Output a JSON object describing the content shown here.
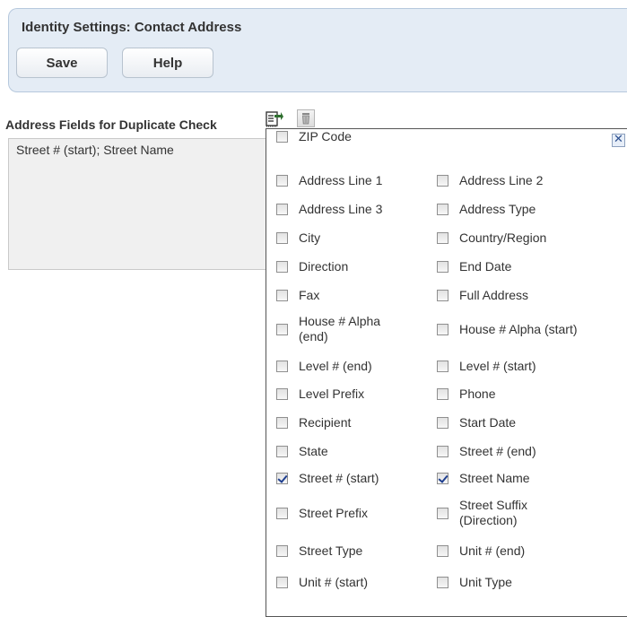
{
  "header": {
    "title": "Identity Settings: Contact Address",
    "save_label": "Save",
    "help_label": "Help"
  },
  "section": {
    "label": "Address Fields for Duplicate Check",
    "value": "Street # (start); Street Name",
    "select_icon": "select-list-icon",
    "clear_icon": "trash-icon"
  },
  "popup": {
    "close_glyph": "✕",
    "options": [
      {
        "label": "Address Line 1",
        "checked": false
      },
      {
        "label": "Address Line 2",
        "checked": false
      },
      {
        "label": "Address Line 3",
        "checked": false
      },
      {
        "label": "Address Type",
        "checked": false
      },
      {
        "label": "City",
        "checked": false
      },
      {
        "label": "Country/Region",
        "checked": false
      },
      {
        "label": "Direction",
        "checked": false
      },
      {
        "label": "End Date",
        "checked": false
      },
      {
        "label": "Fax",
        "checked": false
      },
      {
        "label": "Full Address",
        "checked": false
      },
      {
        "label": "House # Alpha (end)",
        "checked": false
      },
      {
        "label": "House # Alpha (start)",
        "checked": false
      },
      {
        "label": "Level # (end)",
        "checked": false
      },
      {
        "label": "Level # (start)",
        "checked": false
      },
      {
        "label": "Level Prefix",
        "checked": false
      },
      {
        "label": "Phone",
        "checked": false
      },
      {
        "label": "Recipient",
        "checked": false
      },
      {
        "label": "Start Date",
        "checked": false
      },
      {
        "label": "State",
        "checked": false
      },
      {
        "label": "Street # (end)",
        "checked": false
      },
      {
        "label": "Street # (start)",
        "checked": true
      },
      {
        "label": "Street Name",
        "checked": true
      },
      {
        "label": "Street Prefix",
        "checked": false
      },
      {
        "label": "Street Suffix (Direction)",
        "checked": false
      },
      {
        "label": "Street Type",
        "checked": false
      },
      {
        "label": "Unit # (end)",
        "checked": false
      },
      {
        "label": "Unit # (start)",
        "checked": false
      },
      {
        "label": "Unit Type",
        "checked": false
      },
      {
        "label": "ZIP Code",
        "checked": false
      }
    ]
  }
}
